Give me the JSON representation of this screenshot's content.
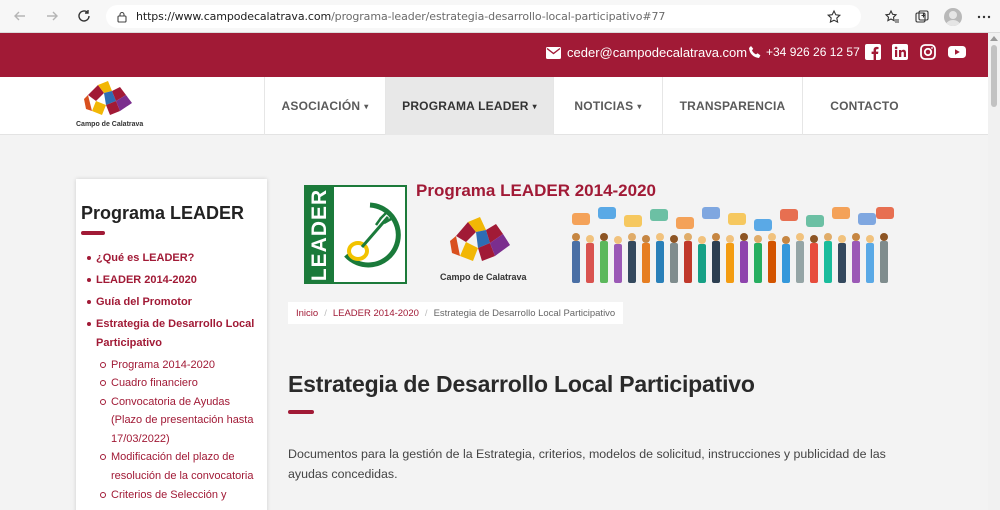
{
  "browser": {
    "url_main": "https://www.campodecalatrava.com",
    "url_rest": "/programa-leader/estrategia-desarrollo-local-participativo#77"
  },
  "topbar": {
    "email": "ceder@campodecalatrava.com",
    "phone": "+34 926 26 12 57",
    "icons": [
      "envelope-icon",
      "phone-icon",
      "facebook-icon",
      "linkedin-icon",
      "instagram-icon",
      "youtube-icon"
    ],
    "color": "#a11a36"
  },
  "header": {
    "logo_text": "Campo de Calatrava",
    "nav": [
      {
        "label": "ASOCIACIÓN",
        "caret": "▾"
      },
      {
        "label": "PROGRAMA LEADER",
        "caret": "▾"
      },
      {
        "label": "NOTICIAS",
        "caret": "▾"
      },
      {
        "label": "TRANSPARENCIA"
      },
      {
        "label": "CONTACTO"
      }
    ]
  },
  "sidebar": {
    "title": "Programa LEADER",
    "items": [
      {
        "label": "¿Qué es LEADER?"
      },
      {
        "label": "LEADER 2014-2020"
      },
      {
        "label": "Guía del Promotor"
      },
      {
        "label": "Estrategia de Desarrollo Local Participativo"
      }
    ],
    "subitems": [
      {
        "label": "Programa 2014-2020"
      },
      {
        "label": "Cuadro financiero"
      },
      {
        "label": "Convocatoria de Ayudas (Plazo de presentación hasta 17/03/2022)"
      },
      {
        "label": "Modificación del plazo de resolución de la convocatoria"
      },
      {
        "label": "Criterios de Selección y"
      }
    ]
  },
  "banner": {
    "leader_word": "LEADER",
    "title": "Programa LEADER 2014-2020",
    "logo_text": "Campo de Calatrava"
  },
  "breadcrumb": {
    "home": "Inicio",
    "sep": "/",
    "parent": "LEADER 2014-2020",
    "current": "Estrategia de Desarrollo Local Participativo"
  },
  "main": {
    "title": "Estrategia de Desarrollo Local Participativo",
    "intro": "Documentos para la gestión de la Estrategia, criterios, modelos de solicitud, instrucciones y publicidad de las ayudas concedidas."
  }
}
